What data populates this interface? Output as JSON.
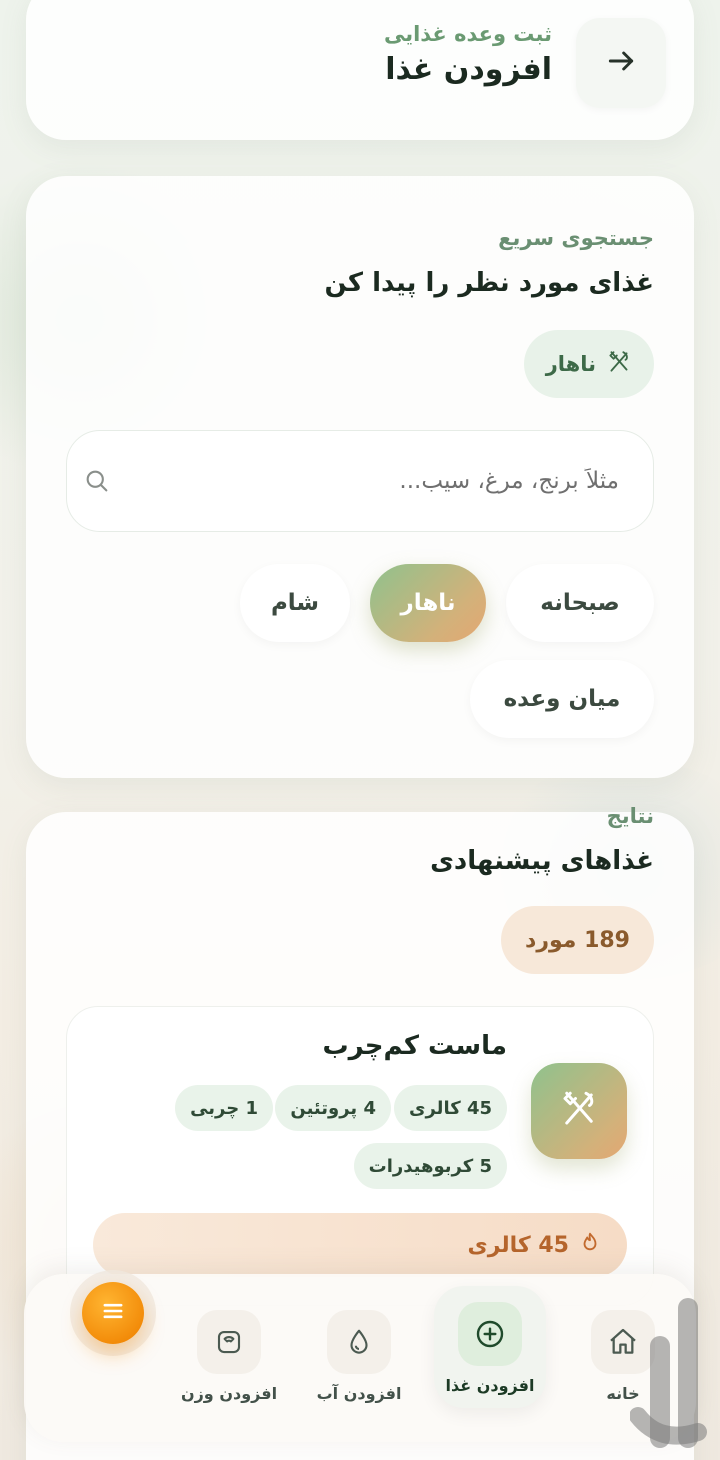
{
  "header": {
    "subtitle": "ثبت وعده غذایی",
    "title": "افزودن غذا",
    "back_icon": "arrow-right-icon"
  },
  "search_section": {
    "kicker": "جستجوی سریع",
    "title": "غذای مورد نظر را پیدا کن",
    "selected_meal": "ناهار",
    "search_placeholder": "مثلاً برنج، مرغ، سیب...",
    "meal_filters": [
      {
        "label": "صبحانه",
        "active": false
      },
      {
        "label": "ناهار",
        "active": true
      },
      {
        "label": "شام",
        "active": false
      },
      {
        "label": "میان وعده",
        "active": false
      }
    ]
  },
  "suggestions": {
    "kicker": "نتایج",
    "title": "غذاهای پیشنهادی",
    "count_label": "189 مورد",
    "foods": [
      {
        "name": "ماست کم‌چرب",
        "nutrients": [
          "45 کالری",
          "4 پروتئین",
          "1 چربی",
          "5 کربوهیدرات"
        ],
        "calories_label": "45 کالری"
      }
    ]
  },
  "bottom_nav": {
    "items": [
      {
        "label": "خانه",
        "icon": "home-icon",
        "active": false
      },
      {
        "label": "افزودن غذا",
        "icon": "plus-circle-icon",
        "active": true
      },
      {
        "label": "افزودن آب",
        "icon": "water-drop-icon",
        "active": false
      },
      {
        "label": "افزودن وزن",
        "icon": "scale-icon",
        "active": false
      }
    ],
    "menu_icon": "menu-icon"
  },
  "colors": {
    "accent_green": "#8fc28d",
    "accent_orange": "#e4a772",
    "menu_fab": "#f28a08",
    "calorie_text": "#b5652c"
  }
}
